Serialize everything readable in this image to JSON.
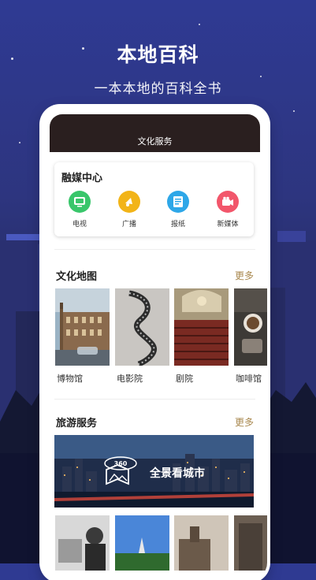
{
  "header": {
    "title": "本地百科",
    "subtitle": "一本本地的百科全书"
  },
  "phone": {
    "top_title": "文化服务"
  },
  "media_center": {
    "title": "融媒中心",
    "items": [
      {
        "label": "电视",
        "icon": "tv-icon",
        "color": "#39c66b"
      },
      {
        "label": "广播",
        "icon": "broadcast-icon",
        "color": "#f2b418"
      },
      {
        "label": "报纸",
        "icon": "newspaper-icon",
        "color": "#2ea7e8"
      },
      {
        "label": "新媒体",
        "icon": "new-media-icon",
        "color": "#f2566b"
      }
    ]
  },
  "culture_map": {
    "title": "文化地图",
    "more": "更多",
    "items": [
      {
        "label": "博物馆"
      },
      {
        "label": "电影院"
      },
      {
        "label": "剧院"
      },
      {
        "label": "咖啡馆"
      }
    ]
  },
  "travel": {
    "title": "旅游服务",
    "more": "更多",
    "banner_text": "全景看城市",
    "banner_badge": "360"
  },
  "colors": {
    "accent_more": "#a8874d",
    "sky_top": "#2f3a93",
    "phone_header": "#2a1f1f"
  }
}
